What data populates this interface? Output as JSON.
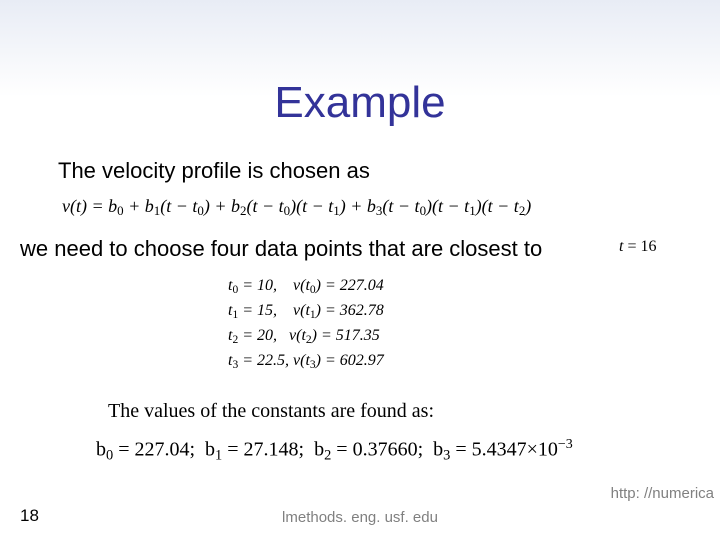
{
  "title": "Example",
  "line1": "The velocity profile is chosen as",
  "eq1_html": "v(t) = b<sub>0</sub> + b<sub>1</sub>(t − t<sub>0</sub>) + b<sub>2</sub>(t − t<sub>0</sub>)(t − t<sub>1</sub>) + b<sub>3</sub>(t − t<sub>0</sub>)(t − t<sub>1</sub>)(t − t<sub>2</sub>)",
  "line2": "we need to choose four data points that are closest to",
  "t_target_html": "t <span class='upright'>= 16</span>",
  "datapoints": [
    "t<sub>0</sub> = 10,&nbsp;&nbsp;&nbsp;&nbsp;v(t<sub>0</sub>) = 227.04",
    "t<sub>1</sub> = 15,&nbsp;&nbsp;&nbsp;&nbsp;v(t<sub>1</sub>) = 362.78",
    "t<sub>2</sub> = 20,&nbsp;&nbsp;&nbsp;v(t<sub>2</sub>) = 517.35",
    "t<sub>3</sub> = 22.5,&nbsp;v(t<sub>3</sub>) = 602.97"
  ],
  "values_note": "The values of the constants are found as:",
  "constants_html": "b<sub>0</sub> = 227.04;&nbsp; b<sub>1</sub> = 27.148;&nbsp; b<sub>2</sub> = 0.37660;&nbsp; b<sub>3</sub> = 5.4347×10<sup style='font-size:0.7em'>−3</sup>",
  "page_number": "18",
  "footer_center": "lmethods. eng. usf. edu",
  "footer_right": "http: //numerica"
}
